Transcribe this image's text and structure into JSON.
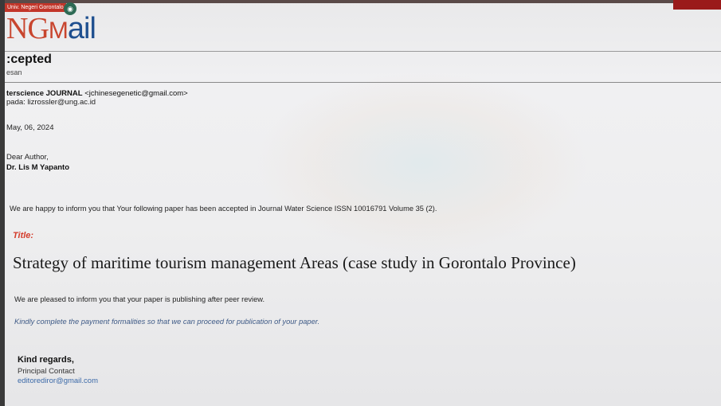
{
  "app": {
    "logo_tag": "Univ. Negeri Gorontalo",
    "logo_ng": "NG",
    "logo_m": "M",
    "logo_ail": "ail",
    "logo_badge": "◉"
  },
  "email": {
    "subject": ":cepted",
    "subject_tag": "esan",
    "sender_name": "terscience JOURNAL",
    "sender_address": "<jchinesegenetic@gmail.com>",
    "recipient": "pada: lizrossler@ung.ac.id",
    "date": "May, 06, 2024",
    "greeting": "Dear Author,",
    "author_name": "Dr. Lis M Yapanto",
    "intro": "We are happy to inform you that Your following paper has been accepted in Journal Water Science ISSN 10016791 Volume 35 (2).",
    "title_label": "Title:",
    "paper_title": "Strategy of maritime tourism management Areas (case study in Gorontalo Province)",
    "pleased": "We are pleased to inform you that your paper is publishing after peer review.",
    "kindly": "Kindly complete the payment formalities so that we can proceed for publication of your paper.",
    "regards": "Kind regards,",
    "contact_role": "Principal Contact",
    "contact_email": "editoredir​or@gmail.com"
  },
  "colors": {
    "logo_red": "#c8452e",
    "logo_blue": "#1e4f8f",
    "title_red": "#d43b2a",
    "link_blue": "#3c6aa8"
  }
}
